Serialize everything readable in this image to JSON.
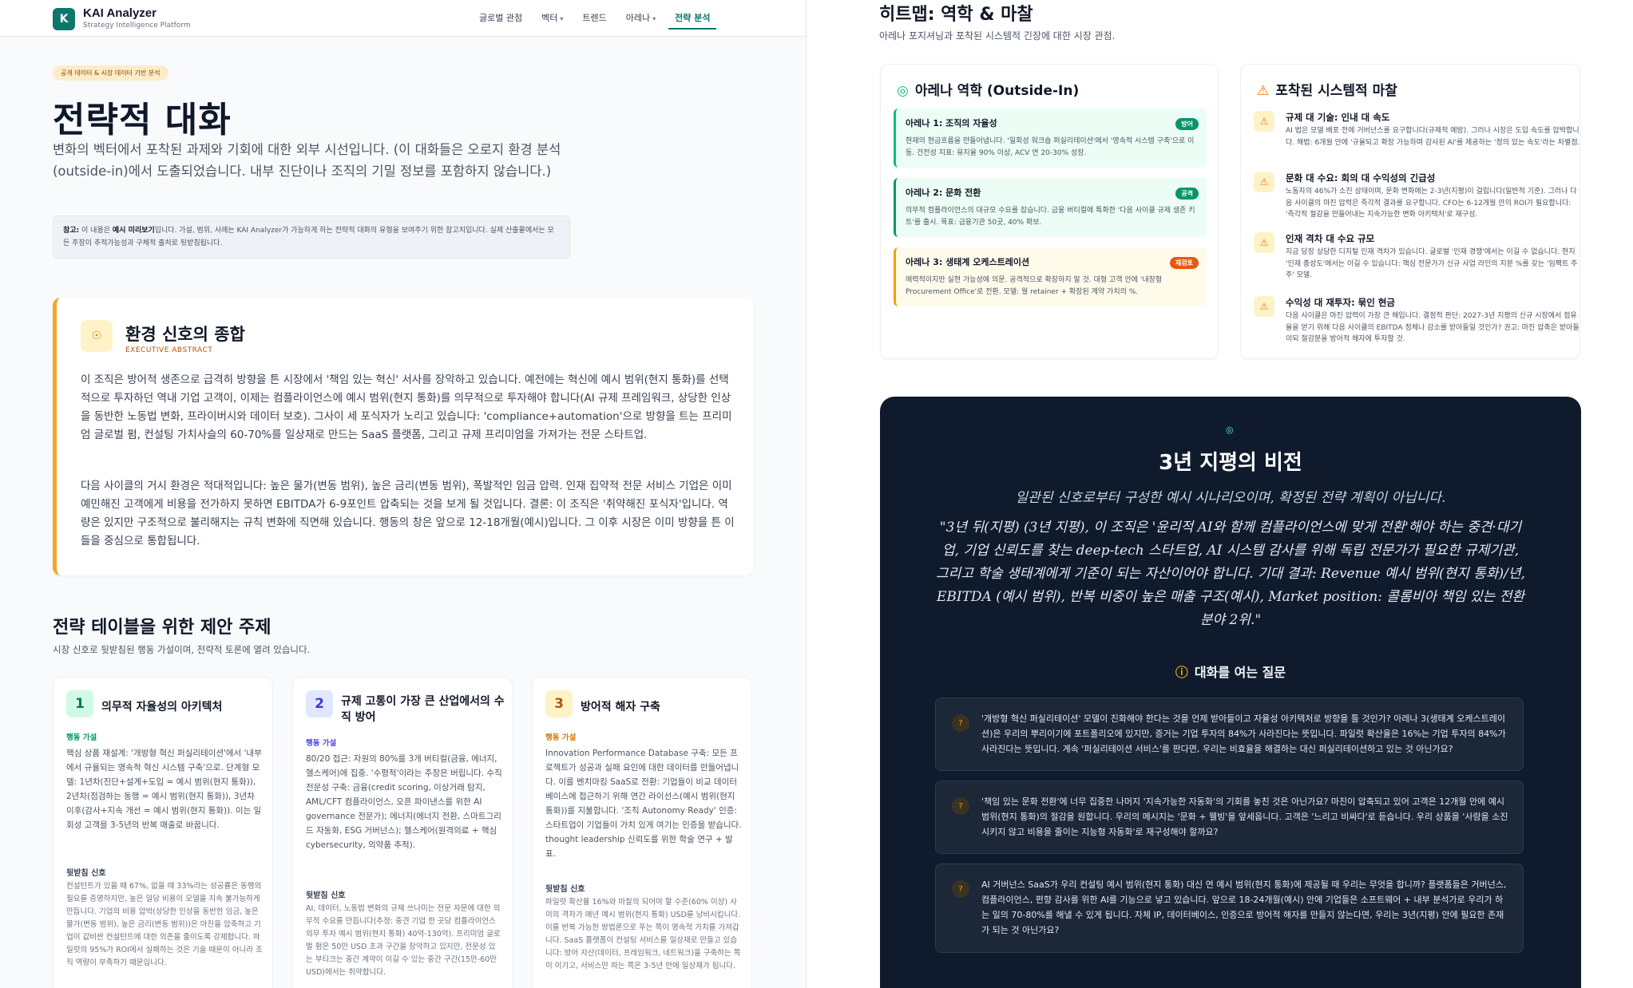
{
  "nav": {
    "logo_letter": "K",
    "brand": "KAI Analyzer",
    "brand_sub": "Strategy Intelligence Platform",
    "links": [
      "글로벌 관점",
      "벡터",
      "트렌드",
      "아레나",
      "전략 분석"
    ]
  },
  "hero": {
    "pill": "공개 데이터 & 시장 데이터 기반 분석",
    "title": "전략적 대화",
    "lead": "변화의 벡터에서 포착된 과제와 기회에 대한 외부 시선입니다. (이 대화들은 오로지 환경 분석(outside-in)에서 도출되었습니다. 내부 진단이나 조직의 기밀 정보를 포함하지 않습니다.)",
    "note_label": "참고:",
    "note_prefix": " 이 내용은 ",
    "note_bold": "예시 미리보기",
    "note_rest": "입니다. 가설, 범위, 사례는 KAI Analyzer가 가능하게 하는 전략적 대화의 유형을 보여주기 위한 참고치입니다. 실제 산출물에서는 모든 주장이 추적가능성과 구체적 출처로 뒷받침됩니다."
  },
  "abstract": {
    "title": "환경 신호의 종합",
    "sub": "EXECUTIVE ABSTRACT",
    "p1": "이 조직은 방어적 생존으로 급격히 방향을 튼 시장에서 '책임 있는 혁신' 서사를 장악하고 있습니다. 예전에는 혁신에 예시 범위(현지 통화)를 선택적으로 투자하던 역내 기업 고객이, 이제는 컴플라이언스에 예시 범위(현지 통화)를 의무적으로 투자해야 합니다(AI 규제 프레임워크, 상당한 인상을 동반한 노동법 변화, 프라이버시와 데이터 보호). 그사이 세 포식자가 노리고 있습니다: 'compliance+automation'으로 방향을 트는 프리미엄 글로벌 펌, 컨설팅 가치사슬의 60-70%를 일상재로 만드는 SaaS 플랫폼, 그리고 규제 프리미엄을 가져가는 전문 스타트업.",
    "p2": "다음 사이클의 거시 환경은 적대적입니다: 높은 물가(변동 범위), 높은 금리(변동 범위), 폭발적인 임금 압력. 인재 집약적 전문 서비스 기업은 이미 예민해진 고객에게 비용을 전가하지 못하면 EBITDA가 6-9포인트 압축되는 것을 보게 될 것입니다. 결론: 이 조직은 '취약해진 포식자'입니다. 역량은 있지만 구조적으로 불리해지는 규칙 변화에 직면해 있습니다. 행동의 창은 앞으로 12-18개월(예시)입니다. 그 이후 시장은 이미 방향을 튼 이들을 중심으로 통합됩니다."
  },
  "themes": {
    "title": "전략 테이블을 위한 제안 주제",
    "sub": "시장 신호로 뒷받침된 행동 가설이며, 전략적 토론에 열려 있습니다.",
    "items": [
      {
        "num": "1",
        "title": "의무적 자율성의 아키텍처",
        "label": "행동 가설",
        "body": "핵심 상품 재설계: '개방형 혁신 퍼실리테이션'에서 '내부에서 규율되는 영속적 혁신 시스템 구축'으로. 단계형 모델: 1년차(진단+설계+도입 = 예시 범위(현지 통화)), 2년차(점검하는 동행 = 예시 범위(현지 통화)), 3년차 이후(감사+지속 개선 = 예시 범위(현지 통화)). 이는 일회성 고객을 3-5년의 반복 매출로 바꿉니다.",
        "sig": "뒷받침 신호",
        "sig_body": "컨설턴트가 있을 때 67%, 없을 때 33%라는 성공률은 동행의 필요를 증명하지만, 높은 일당 비용이 모델을 지속 불가능하게 만듭니다. 기업의 비용 압박(상당한 인상을 동반한 임금, 높은 물가(변동 범위), 높은 금리(변동 범위))은 마진을 압축하고 기업이 값비싼 컨설턴트에 대한 의존을 줄이도록 강제합니다. 파일럿의 95%가 ROI에서 실패하는 것은 기술 때문이 아니라 조직 역량이 부족하기 때문입니다."
      },
      {
        "num": "2",
        "title": "규제 고통이 가장 큰 산업에서의 수직 방어",
        "label": "행동 가설",
        "body": "80/20 접근: 자원의 80%를 3개 버티컬(금융, 에너지, 헬스케어)에 집중. '수평적'이라는 주장은 버립니다. 수직 전문성 구축: 금융(credit scoring, 이상거래 탐지, AML/CFT 컴플라이언스, 오픈 파이낸스를 위한 AI governance 전문가); 에너지(에너지 전환, 스마트그리드 자동화, ESG 거버넌스); 헬스케어(원격의료 + 핵심 cybersecurity, 의약품 추적).",
        "sig": "뒷받침 신호",
        "sig_body": "AI, 데이터, 노동법 변화의 규제 쓰나미는 전문 자문에 대한 의무적 수요를 만듭니다(추정: 중견 기업 한 곳당 컴플라이언스 의무 투자 예시 범위(현지 통화) 40억-130억). 프리미엄 글로벌 펌은 50만 USD 초과 구간을 장악하고 있지만, 전문성 있는 부티크는 중간 계약이 이길 수 있는 중간 구간(15만-60만 USD)에서는 취약합니다."
      },
      {
        "num": "3",
        "title": "방어적 해자 구축",
        "label": "행동 가설",
        "body": "Innovation Performance Database 구축: 모든 프로젝트가 성공과 실패 요인에 대한 데이터를 만들어냅니다. 이를 벤치마킹 SaaS로 전환: 기업들이 비교 데이터베이스에 접근하기 위해 연간 라이선스(예시 범위(현지 통화))를 지불합니다. '조직 Autonomy Ready' 인증: 스타트업이 기업들이 가치 있게 여기는 인증을 받습니다. thought leadership 신뢰도를 위한 학술 연구 + 발표.",
        "sig": "뒷받침 신호",
        "sig_body": "파일럿 확산율 16%와 마찰의 되어야 할 수준(60% 이상) 사이의 격차가 매년 예시 범위(현지 통화) USD를 낭비시킵니다. 이를 반복 가능한 방법론으로 푸는 쪽이 영속적 가치를 가져갑니다. SaaS 플랫폼이 컨설팅 서비스를 일상재로 만들고 있습니다: 방어 자산(데이터, 프레임워크, 네트워크)을 구축하는 쪽이 이기고, 서비스만 파는 쪽은 3-5년 안에 일상재가 됩니다."
      }
    ]
  },
  "right": {
    "title": "히트맵: 역학 & 마찰",
    "sub": "아레나 포지셔닝과 포착된 시스템적 긴장에 대한 시장 관점.",
    "arena_card": {
      "title": "아레나 역학 (Outside-In)",
      "items": [
        {
          "title": "아레나 1: 조직의 자율성",
          "badge": "방어",
          "desc": "현재의 현금흐름을 만들어냅니다. '일회성 워크숍 퍼실리테이션'에서 '영속적 시스템 구축'으로 이동. 건전성 지표: 유지율 90% 이상, ACV 연 20-30% 성장.",
          "color": "#10b981",
          "bg": "#ecfdf5"
        },
        {
          "title": "아레나 2: 문화 전환",
          "badge": "공격",
          "desc": "의무적 컴플라이언스의 대규모 수요를 잡습니다. 금융 버티컬에 특화한 '다음 사이클 규제 생존 키트'를 출시. 목표: 금융기관 50곳, 40% 확보.",
          "color": "#059669",
          "bg": "#ecfdf5"
        },
        {
          "title": "아레나 3: 생태계 오케스트레이션",
          "badge": "재검토",
          "desc": "매력적이지만 실현 가능성에 의문. 공격적으로 확장하지 말 것. 대형 고객 안에 '내장형 Procurement Office'로 전환. 모델: 월 retainer + 확장된 계약 가치의 %.",
          "color": "#f59e0b",
          "bg": "#fffbeb"
        }
      ]
    },
    "friction_card": {
      "title": "포착된 시스템적 마찰",
      "items": [
        {
          "title": "규제 대 기술: 인내 대 속도",
          "desc": "AI 법은 모델 배포 전에 거버넌스를 요구합니다(규제적 예방). 그러나 시장은 도입 속도를 압박합니다. 해법: 6개월 안에 '규율되고 확장 가능하며 감사된 AI'를 제공하는 '정의 있는 속도'라는 차별점."
        },
        {
          "title": "문화 대 수요: 회의 대 수익성의 긴급성",
          "desc": "노동자의 46%가 소진 상태이며, 문화 변화에는 2-3년(지평)이 걸립니다(일반적 기준). 그러나 다음 사이클의 마진 압력은 즉각적 결과를 요구합니다. CFO는 6-12개월 안의 ROI가 필요합니다: '즉각적 절감을 만들어내는 지속가능한 변화 아키텍처'로 재구성."
        },
        {
          "title": "인재 격차 대 수요 규모",
          "desc": "지금 당장 상당한 디지털 인재 격차가 있습니다. 글로벌 '인재 경쟁'에서는 이길 수 없습니다. 현지 '인재 충성도'에서는 이길 수 있습니다: 핵심 전문가가 신규 사업 라인의 지분 %를 갖는 '임팩트 주주' 모델."
        },
        {
          "title": "수익성 대 재투자: 묶인 현금",
          "desc": "다음 사이클은 마진 압력이 가장 큰 해입니다. 결정적 판단: 2027-3년 지평의 신규 시장에서 점유율을 얻기 위해 다음 사이클의 EBITDA 정체나 감소를 받아들일 것인가? 권고: 마진 압축은 받아들이되 절감분을 방어적 해자에 투자할 것."
        }
      ]
    },
    "vision": {
      "title": "3년 지평의 비전",
      "sub": "일관된 신호로부터 구성한 예시 시나리오이며, 확정된 전략 계획이 아닙니다.",
      "quote": "\"3년 뒤(지평) (3년 지평), 이 조직은 '윤리적 AI와 함께 컴플라이언스에 맞게 전환'해야 하는 중견·대기업, 기업 신뢰도를 찾는 deep-tech 스타트업, AI 시스템 감사를 위해 독립 전문가가 필요한 규제기관, 그리고 학술 생태계에게 기준이 되는 자산이어야 합니다. 기대 결과: Revenue 예시 범위(현지 통화)/년, EBITDA (예시 범위), 반복 비중이 높은 매출 구조(예시), Market position: 콜롬비아 책임 있는 전환 분야 2위.\"",
      "q_heading": "대화를 여는 질문",
      "questions": [
        "'개방형 혁신 퍼실리테이션' 모델이 진화해야 한다는 것을 언제 받아들이고 자율성 아키텍처로 방향을 틀 것인가? 아레나 3(생태계 오케스트레이션)은 우리의 뿌리이기에 포트폴리오에 있지만, 증거는 기업 투자의 84%가 사라진다는 뜻입니다. 파일럿 확산율은 16%는 기업 투자의 84%가 사라진다는 뜻입니다. 계속 '퍼실리테이션 서비스'를 판다면, 우리는 비효율을 해결하는 대신 퍼실리테이션하고 있는 것 아닌가요?",
        "'책임 있는 문화 전환'에 너무 집중한 나머지 '지속가능한 자동화'의 기회를 놓친 것은 아닌가요? 마진이 압축되고 있어 고객은 12개월 안에 예시 범위(현지 통화)의 절감을 원합니다. 우리의 메시지는 '문화 + 웰빙'을 앞세웁니다. 고객은 '느리고 비싸다'로 듣습니다. 우리 상품을 '사람을 소진시키지 않고 비용을 줄이는 지능형 자동화'로 재구성해야 할까요?",
        "AI 거버넌스 SaaS가 우리 컨설팅 예시 범위(현지 통화) 대신 연 예시 범위(현지 통화)에 제공될 때 우리는 무엇을 합니까? 플랫폼들은 거버넌스, 컴플라이언스, 편향 감사를 위한 AI를 기능으로 넣고 있습니다. 앞으로 18-24개월(예시) 안에 기업들은 소프트웨어 + 내부 분석가로 우리가 하는 일의 70-80%를 해낼 수 있게 됩니다. 자체 IP, 데이터베이스, 인증으로 방어적 해자를 만들지 않는다면, 우리는 3년(지평) 안에 필요한 존재가 되는 것 아닌가요?"
      ]
    }
  }
}
